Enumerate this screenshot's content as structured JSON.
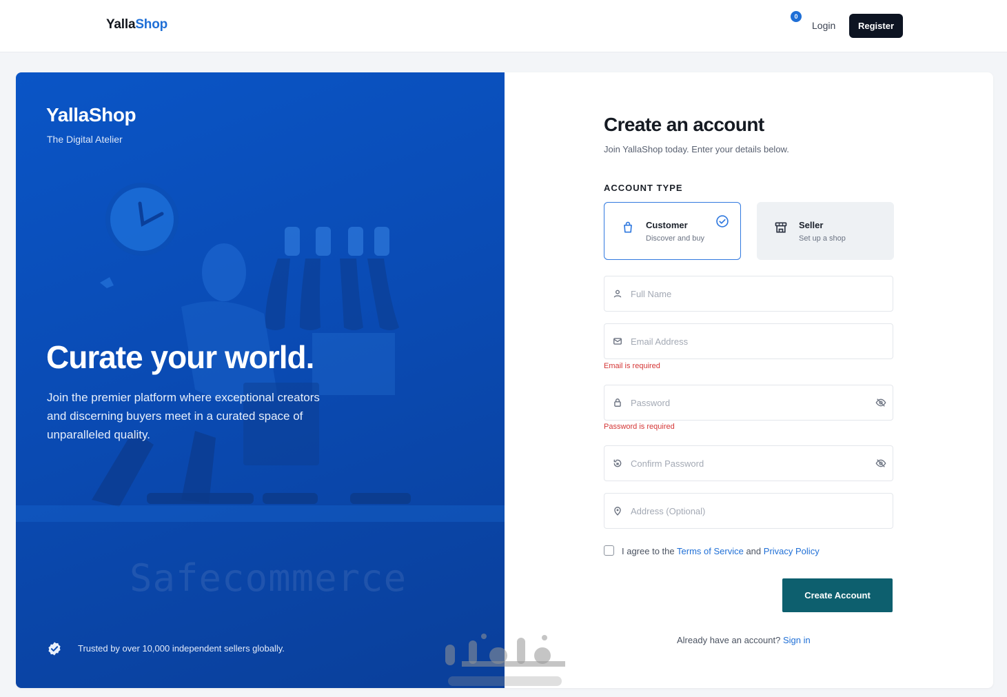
{
  "header": {
    "logo_part1": "Yalla",
    "logo_part2": "Shop",
    "notification_count": "0",
    "login_label": "Login",
    "register_label": "Register"
  },
  "hero": {
    "brand": "YallaShop",
    "tagline": "The Digital Atelier",
    "headline": "Curate your world.",
    "description": "Join the premier platform where exceptional creators and discerning buyers meet in a curated space of unparalleled quality.",
    "image_watermark": "Safecommerce",
    "trust_text": "Trusted by over 10,000 independent sellers globally."
  },
  "form": {
    "title": "Create an account",
    "subtitle": "Join YallaShop today. Enter your details below.",
    "account_type_label": "ACCOUNT TYPE",
    "account_types": [
      {
        "name": "Customer",
        "description": "Discover and buy",
        "icon": "shopping-bag-icon",
        "selected": true
      },
      {
        "name": "Seller",
        "description": "Set up a shop",
        "icon": "storefront-icon",
        "selected": false
      }
    ],
    "full_name": {
      "placeholder": "Full Name",
      "value": ""
    },
    "email": {
      "placeholder": "Email Address",
      "value": "",
      "error": "Email is required"
    },
    "password": {
      "placeholder": "Password",
      "value": "",
      "error": "Password is required"
    },
    "confirm_password": {
      "placeholder": "Confirm Password",
      "value": ""
    },
    "address": {
      "placeholder": "Address (Optional)",
      "value": ""
    },
    "agree": {
      "prefix": "I agree to the",
      "terms_link": "Terms of Service",
      "and": "and",
      "privacy_link": "Privacy Policy",
      "checked": false
    },
    "submit_label": "Create Account",
    "signin_prompt": "Already have an account?",
    "signin_link": "Sign in"
  },
  "colors": {
    "accent": "#1f6fd6",
    "hero_blue": "#0a4bb4",
    "create_button": "#0d5f6e",
    "error": "#d43535",
    "register_button": "#0d1422"
  }
}
